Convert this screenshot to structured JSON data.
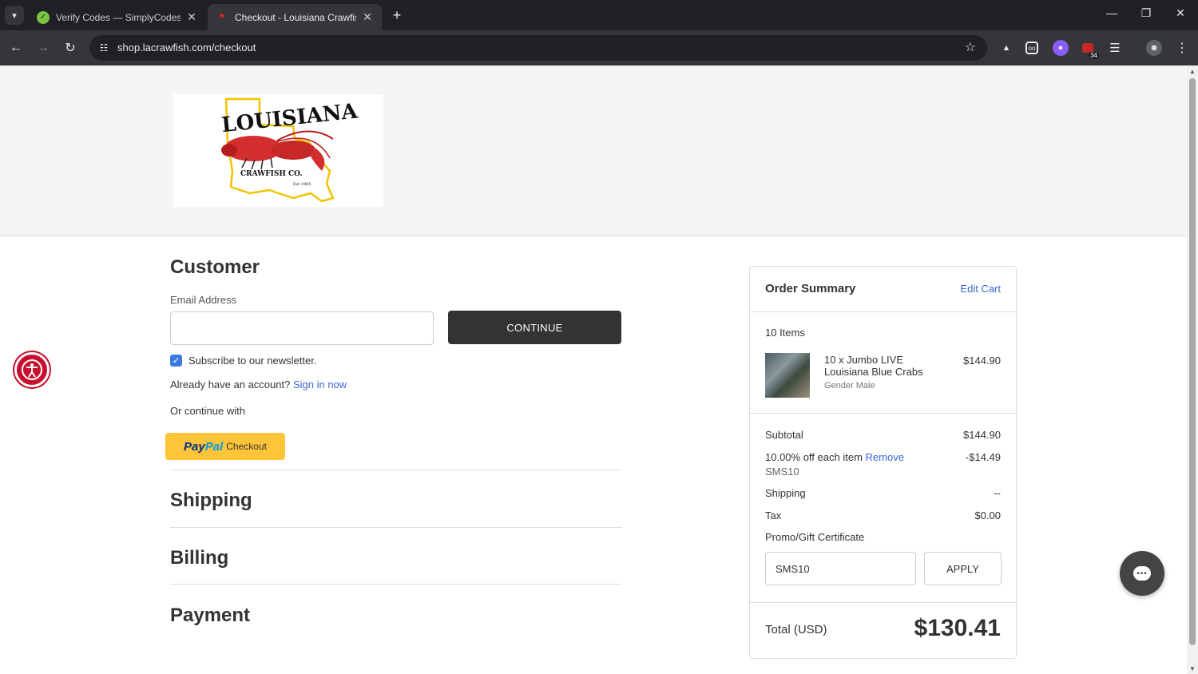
{
  "browser": {
    "tabs": [
      {
        "title": "Verify Codes — SimplyCodes",
        "active": false
      },
      {
        "title": "Checkout - Louisiana Crawfish Co",
        "active": true
      }
    ],
    "url": "shop.lacrawfish.com/checkout",
    "extension_badge": "34"
  },
  "logo": {
    "word": "LOUISIANA",
    "company": "CRAWFISH CO.",
    "est": "Est 1985"
  },
  "customer": {
    "heading": "Customer",
    "email_label": "Email Address",
    "email_value": "",
    "continue_label": "CONTINUE",
    "subscribe_label": "Subscribe to our newsletter.",
    "subscribe_checked": true,
    "account_prompt": "Already have an account?",
    "sign_in_label": "Sign in now",
    "or_continue": "Or continue with",
    "paypal_pay": "Pay",
    "paypal_pal": "Pal",
    "paypal_checkout": "Checkout"
  },
  "sections": {
    "shipping": "Shipping",
    "billing": "Billing",
    "payment": "Payment"
  },
  "summary": {
    "title": "Order Summary",
    "edit_cart": "Edit Cart",
    "items_count": "10 Items",
    "item": {
      "name_line1": "10 x Jumbo LIVE",
      "name_line2": "Louisiana Blue Crabs",
      "option": "Gender Male",
      "price": "$144.90"
    },
    "subtotal_label": "Subtotal",
    "subtotal_value": "$144.90",
    "discount_label": "10.00% off each item",
    "discount_remove": "Remove",
    "discount_code": "SMS10",
    "discount_value": "-$14.49",
    "shipping_label": "Shipping",
    "shipping_value": "--",
    "tax_label": "Tax",
    "tax_value": "$0.00",
    "promo_link": "Promo/Gift Certificate",
    "promo_value": "SMS10",
    "apply_label": "APPLY",
    "total_label": "Total (USD)",
    "total_value": "$130.41"
  }
}
